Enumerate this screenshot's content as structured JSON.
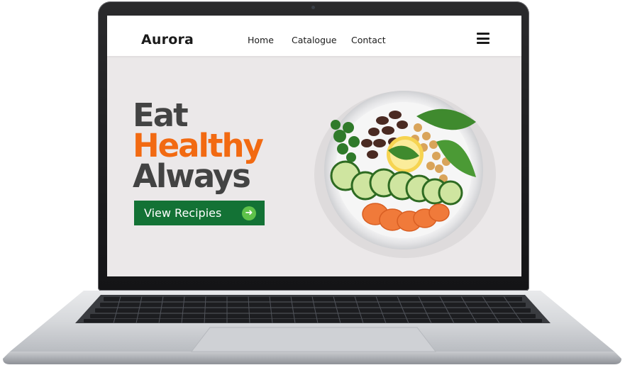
{
  "site": {
    "brand": "Aurora",
    "nav": {
      "home": "Home",
      "catalogue": "Catalogue",
      "contact": "Contact"
    },
    "menu_icon": "hamburger-icon"
  },
  "hero": {
    "line1": "Eat",
    "line2": "Healthy",
    "line3": "Always",
    "cta_label": "View Recipies",
    "cta_icon": "arrow-right-icon"
  },
  "colors": {
    "accent_orange": "#f26a12",
    "heading_gray": "#434343",
    "cta_green": "#137235",
    "cta_icon_green": "#5fc24a",
    "screen_bg": "#ebe8e9"
  },
  "image": {
    "subject": "salad-bowl-image"
  }
}
